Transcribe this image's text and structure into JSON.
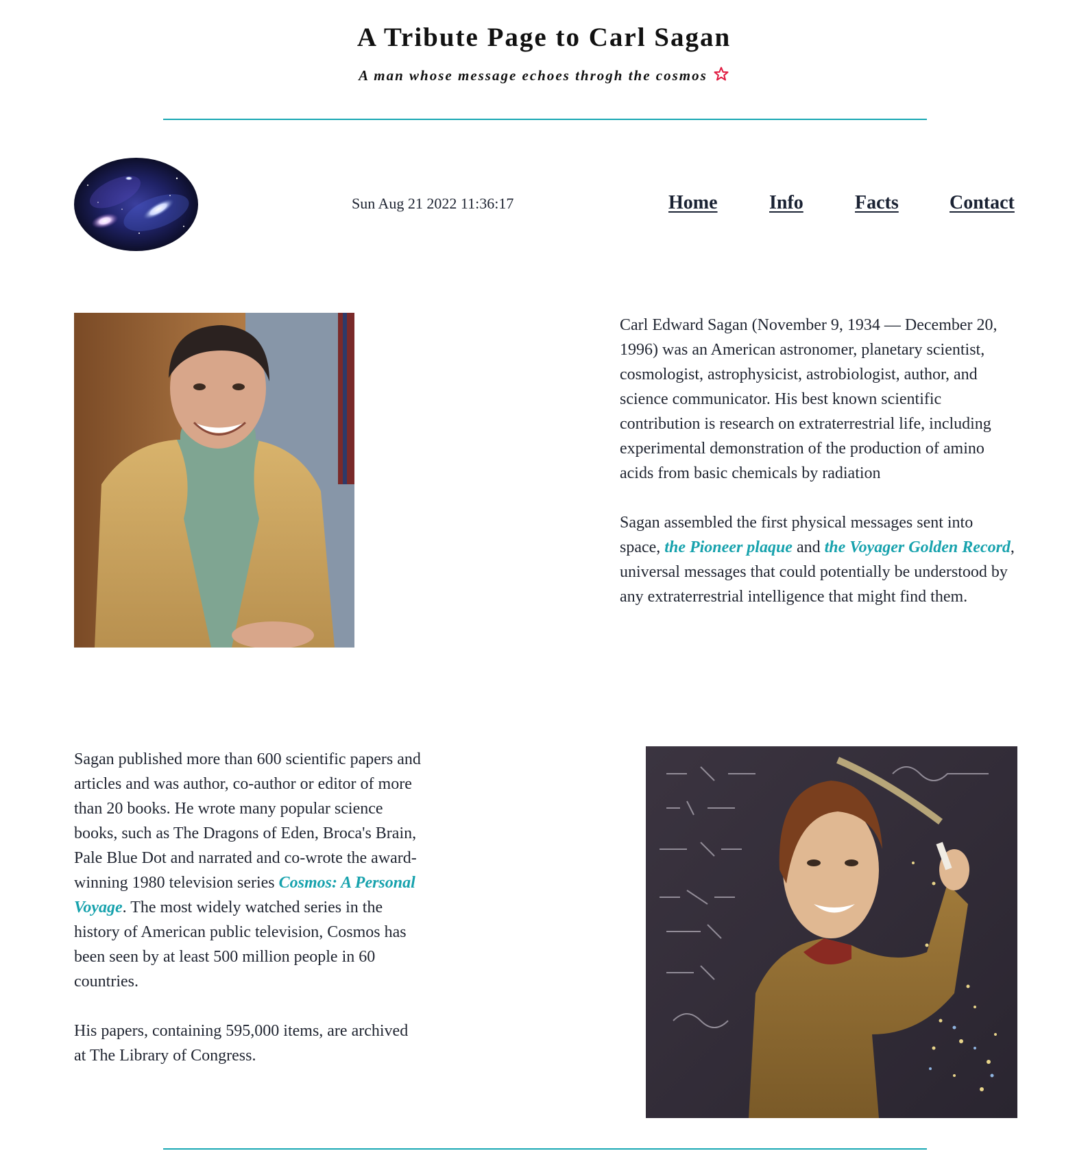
{
  "header": {
    "title": "A Tribute Page to Carl Sagan",
    "subtitle": "A man whose message echoes throgh the cosmos",
    "star_icon": "star-outline-icon",
    "accent_color": "#17a7b3",
    "star_color": "#e0193f"
  },
  "toolbar": {
    "logo_alt": "galaxy-logo",
    "datetime": "Sun Aug 21 2022 11:36:17"
  },
  "nav": {
    "items": [
      {
        "label": "Home"
      },
      {
        "label": "Info"
      },
      {
        "label": "Facts"
      },
      {
        "label": "Contact"
      }
    ]
  },
  "bio": {
    "paragraph1": "Carl Edward Sagan (November 9, 1934 — December 20, 1996) was an American astronomer, planetary scientist, cosmologist, astrophysicist, astrobiologist, author, and science communicator. His best known scientific contribution is research on extraterrestrial life, including experimental demonstration of the production of amino acids from basic chemicals by radiation",
    "paragraph2_start": "Sagan assembled the first physical messages sent into space, ",
    "link_pioneer": "the Pioneer plaque",
    "paragraph2_and": " and ",
    "link_voyager": "the Voyager Golden Record",
    "paragraph2_end": ", universal messages that could potentially be understood by any extraterrestrial intelligence that might find them."
  },
  "works": {
    "paragraph1_start": "Sagan published more than 600 scientific papers and articles and was author, co-author or editor of more than 20 books. He wrote many popular science books, such as The Dragons of Eden, Broca's Brain, Pale Blue Dot and narrated and co-wrote the award-winning 1980 television series ",
    "link_cosmos": "Cosmos: A Personal Voyage",
    "paragraph1_end": ". The most widely watched series in the history of American public television, Cosmos has been seen by at least 500 million people in 60 countries.",
    "paragraph2": "His papers, containing 595,000 items, are archived at The Library of Congress."
  },
  "link_color": "#17a2ad"
}
